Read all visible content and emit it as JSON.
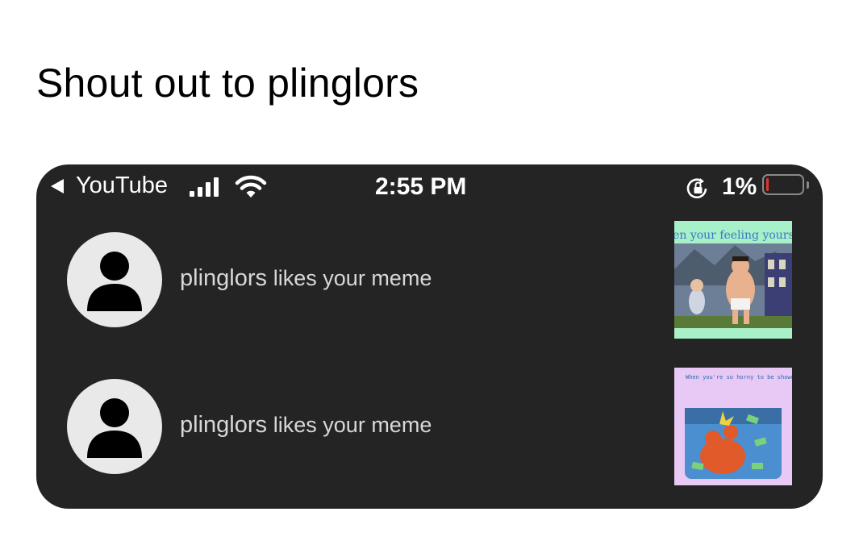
{
  "post": {
    "caption": "Shout out to plinglors"
  },
  "status_bar": {
    "back_app": "YouTube",
    "time": "2:55 PM",
    "battery_percent": "1%",
    "battery_level": 0.01,
    "icons": [
      "back-triangle-icon",
      "cellular-signal-icon",
      "wifi-icon",
      "orientation-lock-icon",
      "battery-icon"
    ],
    "battery_low_color": "#e2332c"
  },
  "notifications": [
    {
      "username": "plinglors",
      "action": "likes your meme",
      "thumbnail_top_text": "hen your feeling yourse",
      "avatar_icon": "person-silhouette-icon"
    },
    {
      "username": "plinglors",
      "action": "likes your meme",
      "thumbnail_top_text": "When you're so horny to be showered with money",
      "avatar_icon": "person-silhouette-icon"
    }
  ],
  "colors": {
    "panel_bg": "#242424",
    "avatar_bg": "#e9e9e9",
    "text_light": "#d8d8d8"
  }
}
